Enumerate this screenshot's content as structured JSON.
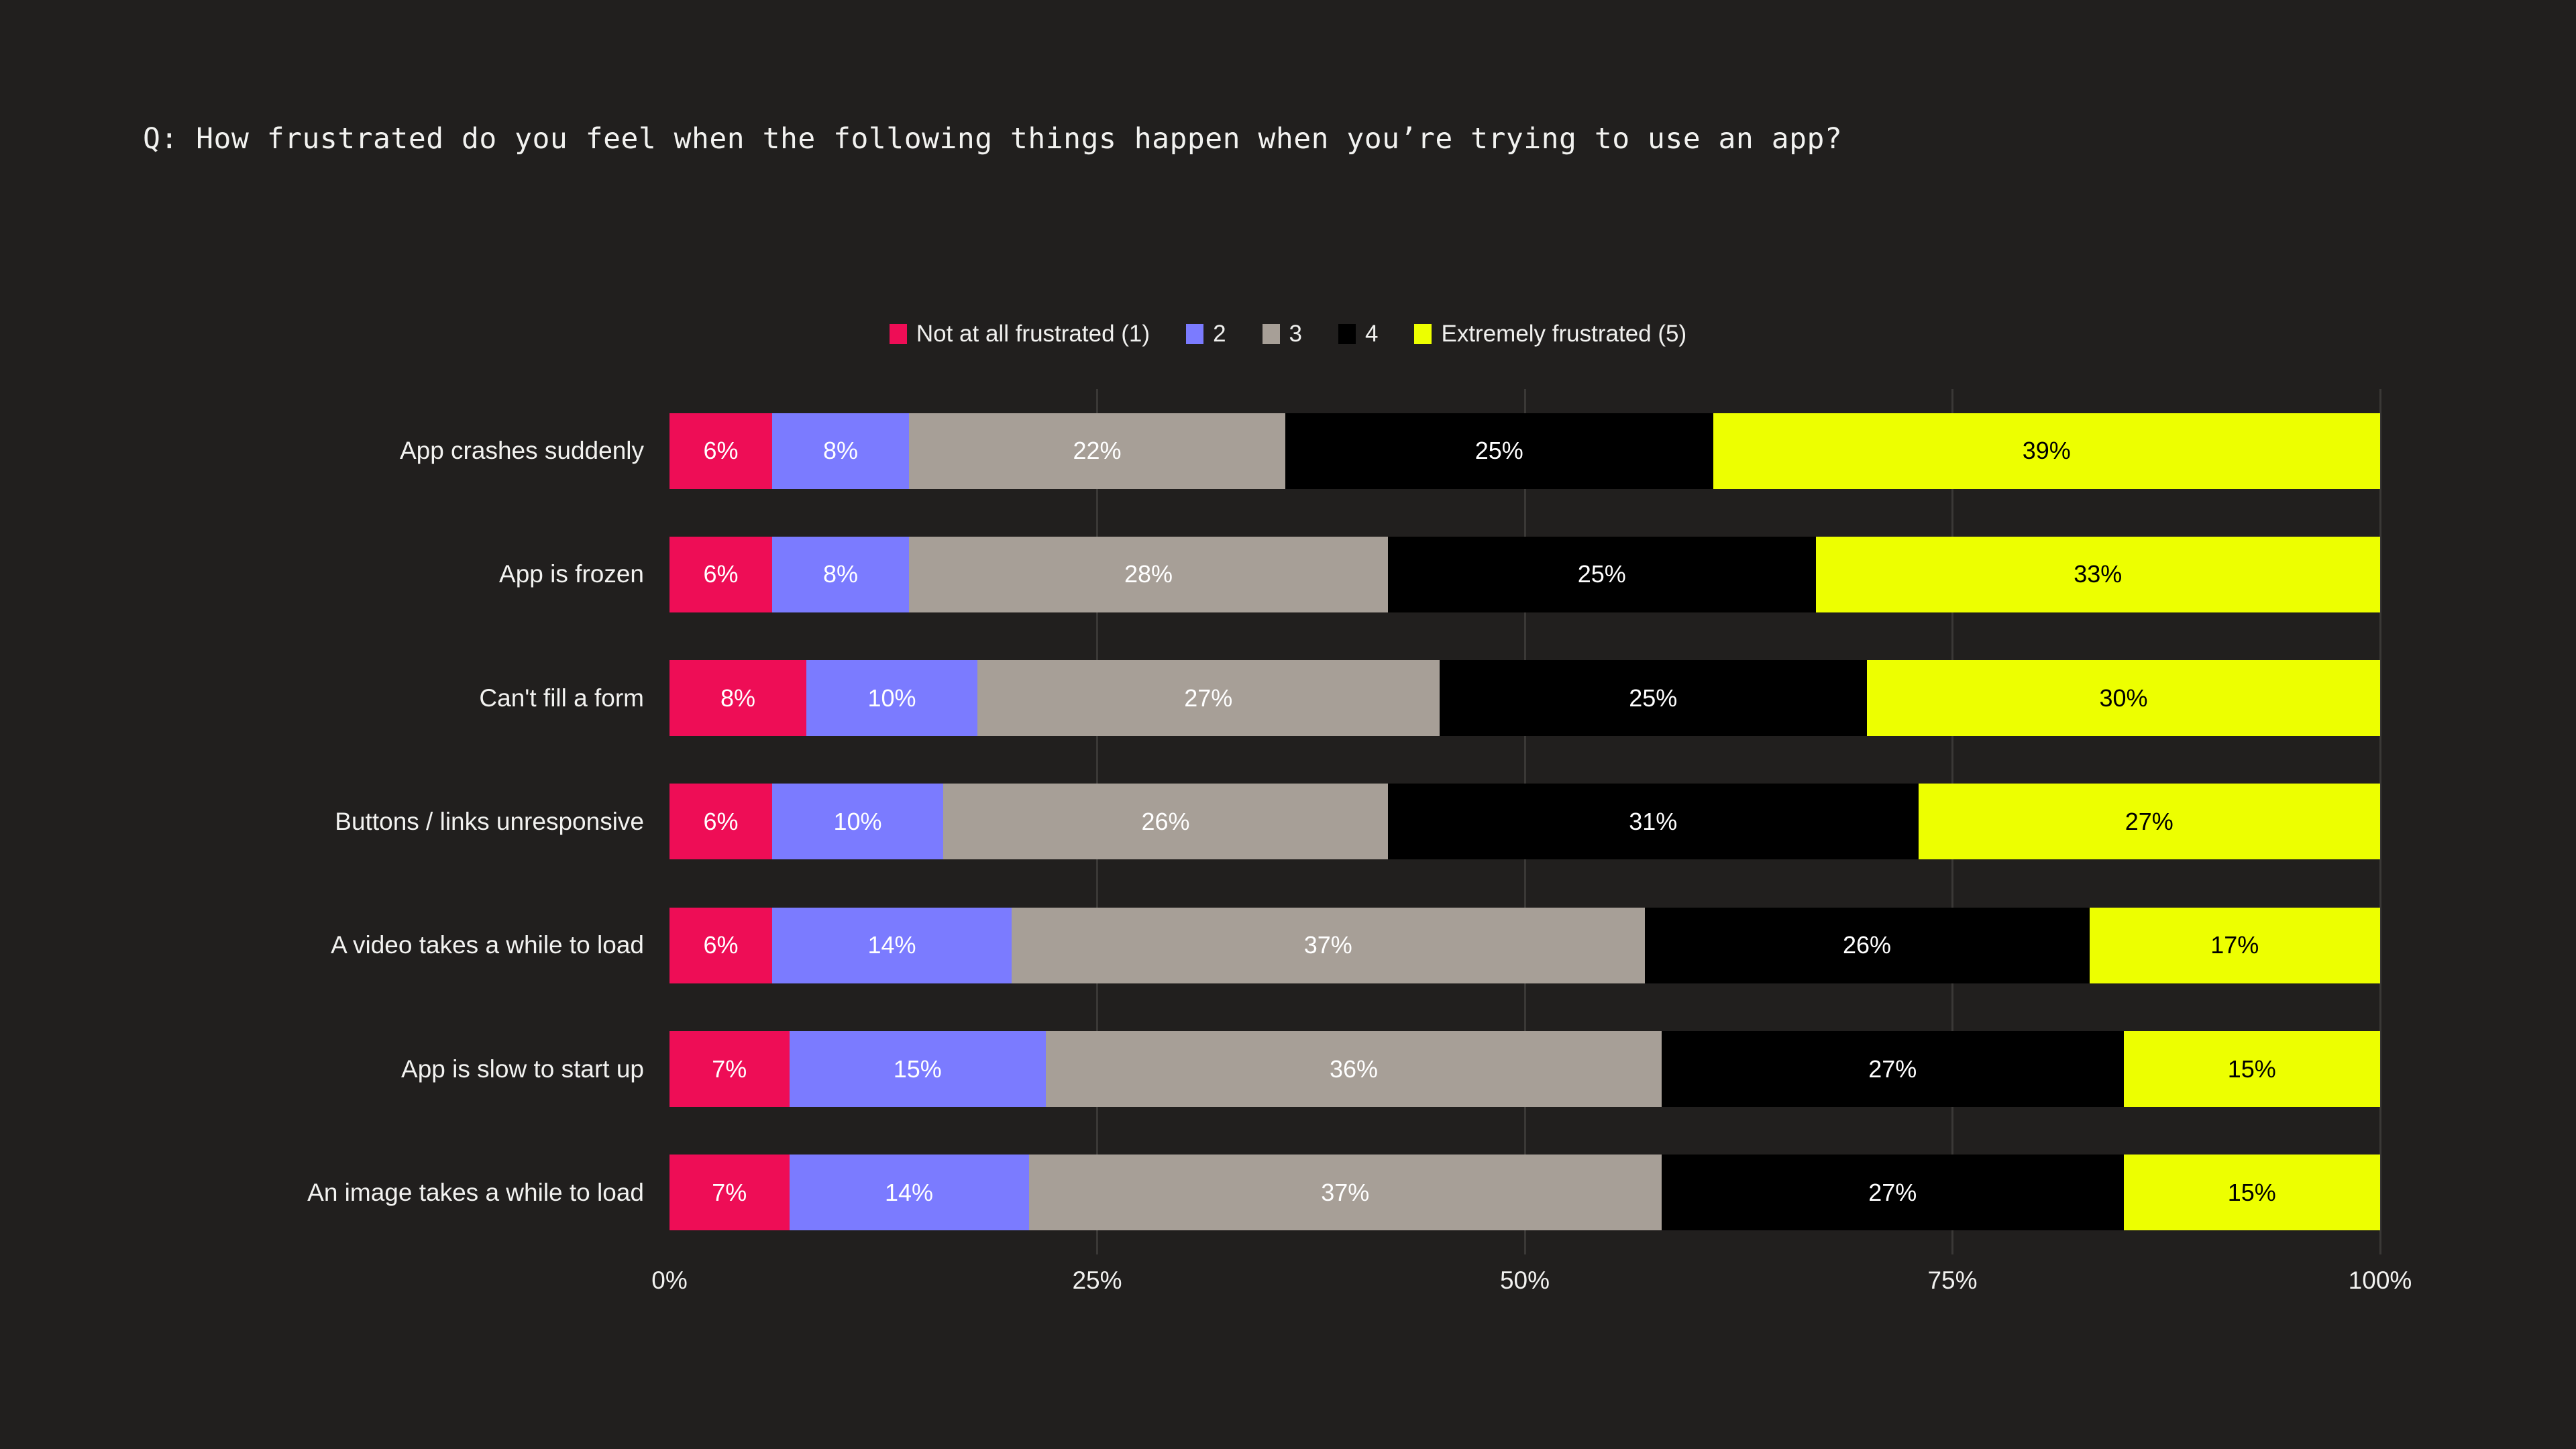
{
  "title": "Q: How frustrated do you feel when the following things happen when you’re trying to use an app?",
  "colors": {
    "background": "#211F1E",
    "gridline": "#3A3836",
    "text": "#F2F2F0",
    "series_1": "#EE0D56",
    "series_2": "#7B7BFF",
    "series_3": "#A79F97",
    "series_4": "#000000",
    "series_5": "#EDFF00"
  },
  "legend": {
    "position": "top-center",
    "items": [
      {
        "label": "Not at all frustrated (1)",
        "color": "#EE0D56"
      },
      {
        "label": "2",
        "color": "#7B7BFF"
      },
      {
        "label": "3",
        "color": "#A79F97"
      },
      {
        "label": "4",
        "color": "#000000"
      },
      {
        "label": "Extremely frustrated (5)",
        "color": "#EDFF00"
      }
    ]
  },
  "axis": {
    "ticks": [
      "0%",
      "25%",
      "50%",
      "75%",
      "100%"
    ],
    "tick_values": [
      0,
      25,
      50,
      75,
      100
    ]
  },
  "chart_data": {
    "type": "bar",
    "orientation": "horizontal",
    "stacked": true,
    "normalized": true,
    "title": "Q: How frustrated do you feel when the following things happen when you’re trying to use an app?",
    "xlabel": "",
    "ylabel": "",
    "xlim": [
      0,
      100
    ],
    "grid": true,
    "legend_position": "top-center",
    "categories": [
      "App crashes suddenly",
      "App is frozen",
      "Can't fill a form",
      "Buttons / links unresponsive",
      "A video takes a while to load",
      "App is slow to start up",
      "An image takes a while to load"
    ],
    "series": [
      {
        "name": "Not at all frustrated (1)",
        "color": "#EE0D56",
        "values": [
          6,
          6,
          8,
          6,
          6,
          7,
          7
        ],
        "labels": [
          "6%",
          "6%",
          "8%",
          "6%",
          "6%",
          "7%",
          "7%"
        ],
        "label_color": "#FFFFFF"
      },
      {
        "name": "2",
        "color": "#7B7BFF",
        "values": [
          8,
          8,
          10,
          10,
          14,
          15,
          14
        ],
        "labels": [
          "8%",
          "8%",
          "10%",
          "10%",
          "14%",
          "15%",
          "14%"
        ],
        "label_color": "#FFFFFF"
      },
      {
        "name": "3",
        "color": "#A79F97",
        "values": [
          22,
          28,
          27,
          26,
          37,
          36,
          37
        ],
        "labels": [
          "22%",
          "28%",
          "27%",
          "26%",
          "37%",
          "36%",
          "37%"
        ],
        "label_color": "#FFFFFF"
      },
      {
        "name": "4",
        "color": "#000000",
        "values": [
          25,
          25,
          25,
          31,
          26,
          27,
          27
        ],
        "labels": [
          "25%",
          "25%",
          "25%",
          "31%",
          "26%",
          "27%",
          "27%"
        ],
        "label_color": "#FFFFFF"
      },
      {
        "name": "Extremely frustrated (5)",
        "color": "#EDFF00",
        "values": [
          39,
          33,
          30,
          27,
          17,
          15,
          15
        ],
        "labels": [
          "39%",
          "33%",
          "30%",
          "27%",
          "17%",
          "15%",
          "15%"
        ],
        "label_color": "#000000"
      }
    ]
  }
}
